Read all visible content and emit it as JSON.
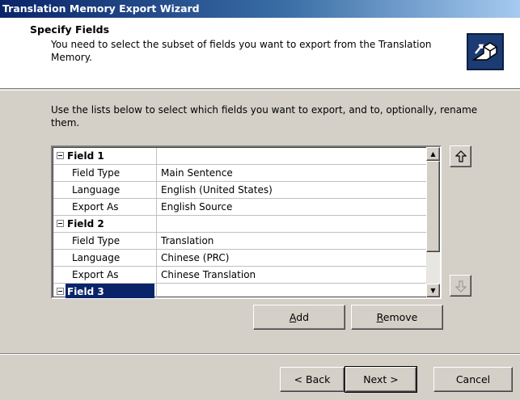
{
  "window": {
    "title": "Translation Memory Export Wizard"
  },
  "header": {
    "title": "Specify Fields",
    "description": "You need to select the subset of fields you want to export from the Translation Memory.",
    "icon": "export-wizard-icon"
  },
  "instructions": "Use the lists below to select which fields you want to export, and to, optionally, rename them.",
  "grid": {
    "rows": [
      {
        "type": "group",
        "label": "Field 1",
        "value": ""
      },
      {
        "type": "prop",
        "label": "Field Type",
        "value": "Main Sentence"
      },
      {
        "type": "prop",
        "label": "Language",
        "value": "English (United States)"
      },
      {
        "type": "prop",
        "label": "Export As",
        "value": "English Source"
      },
      {
        "type": "group",
        "label": "Field 2",
        "value": ""
      },
      {
        "type": "prop",
        "label": "Field Type",
        "value": "Translation"
      },
      {
        "type": "prop",
        "label": "Language",
        "value": "Chinese (PRC)"
      },
      {
        "type": "prop",
        "label": "Export As",
        "value": "Chinese Translation"
      },
      {
        "type": "group",
        "label": "Field 3",
        "value": "",
        "selected": true
      }
    ]
  },
  "buttons": {
    "move_up": "up-arrow-icon",
    "move_down": "down-arrow-icon",
    "add": {
      "pre": "",
      "accel": "A",
      "post": "dd"
    },
    "remove": {
      "pre": "",
      "accel": "R",
      "post": "emove"
    },
    "back": "< Back",
    "next": "Next >",
    "cancel": "Cancel"
  }
}
